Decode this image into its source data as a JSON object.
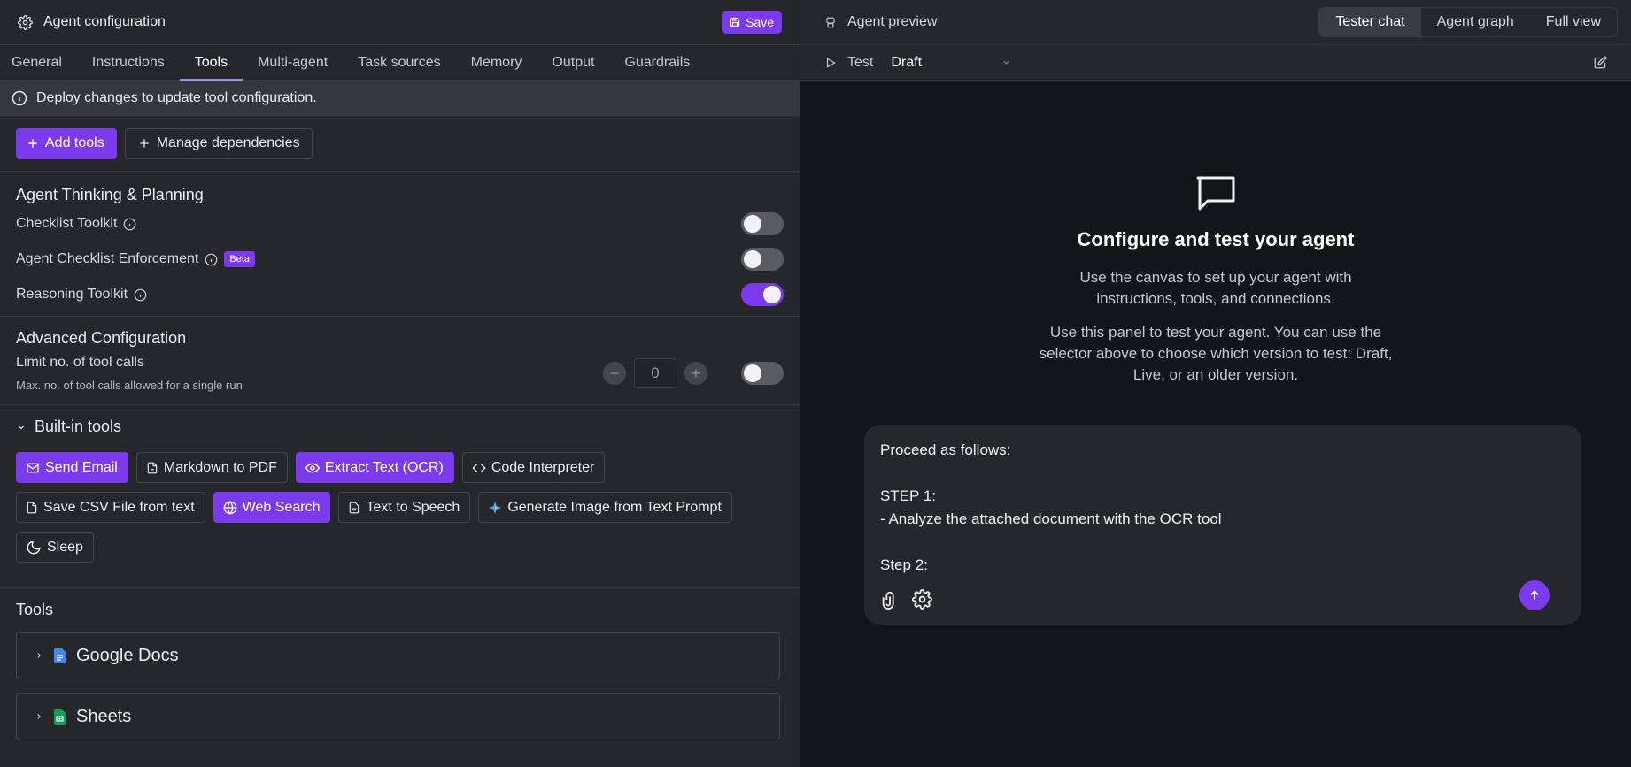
{
  "left": {
    "title": "Agent configuration",
    "save_label": "Save",
    "tabs": [
      "General",
      "Instructions",
      "Tools",
      "Multi-agent",
      "Task sources",
      "Memory",
      "Output",
      "Guardrails"
    ],
    "active_tab": "Tools",
    "notice": "Deploy changes to update tool configuration.",
    "add_tools": "Add tools",
    "manage_dependencies": "Manage dependencies",
    "thinking": {
      "title": "Agent Thinking & Planning",
      "items": [
        {
          "label": "Checklist Toolkit",
          "badge": "",
          "enabled": false
        },
        {
          "label": "Agent Checklist Enforcement",
          "badge": "Beta",
          "enabled": false
        },
        {
          "label": "Reasoning Toolkit",
          "badge": "",
          "enabled": true
        }
      ]
    },
    "advanced": {
      "title": "Advanced Configuration",
      "limit_label": "Limit no. of tool calls",
      "limit_help": "Max. no. of tool calls allowed for a single run",
      "limit_value": "0",
      "enabled": false
    },
    "builtin": {
      "title": "Built-in tools",
      "chips": [
        {
          "label": "Send Email",
          "icon": "mail-icon",
          "on": true
        },
        {
          "label": "Markdown to PDF",
          "icon": "pdf-icon",
          "on": false
        },
        {
          "label": "Extract Text (OCR)",
          "icon": "eye-icon",
          "on": true
        },
        {
          "label": "Code Interpreter",
          "icon": "code-icon",
          "on": false
        },
        {
          "label": "Save CSV File from text",
          "icon": "file-icon",
          "on": false
        },
        {
          "label": "Web Search",
          "icon": "globe-icon",
          "on": true
        },
        {
          "label": "Text to Speech",
          "icon": "audio-file-icon",
          "on": false
        },
        {
          "label": "Generate Image from Text Prompt",
          "icon": "sparkle-icon",
          "on": false
        },
        {
          "label": "Sleep",
          "icon": "moon-icon",
          "on": false
        }
      ]
    },
    "tools": {
      "title": "Tools",
      "items": [
        {
          "label": "Google Docs",
          "icon": "google-docs-icon",
          "color": "#4285f4"
        },
        {
          "label": "Sheets",
          "icon": "google-sheets-icon",
          "color": "#0f9d58"
        }
      ]
    }
  },
  "right": {
    "title": "Agent preview",
    "views": [
      "Tester chat",
      "Agent graph",
      "Full view"
    ],
    "active_view": "Tester chat",
    "test_label": "Test",
    "version": "Draft",
    "empty_title": "Configure and test your agent",
    "empty_p1": "Use the canvas to set up your agent with instructions, tools, and connections.",
    "empty_p2": "Use this panel to test your agent. You can use the selector above to choose which version to test: Draft, Live, or an older version.",
    "composer_text": "Proceed as follows:\n\nSTEP 1:\n- Analyze the attached document with the OCR tool\n\nStep 2:"
  },
  "colors": {
    "accent": "#7c3aed",
    "panel": "#26272b",
    "canvas": "#141518"
  }
}
